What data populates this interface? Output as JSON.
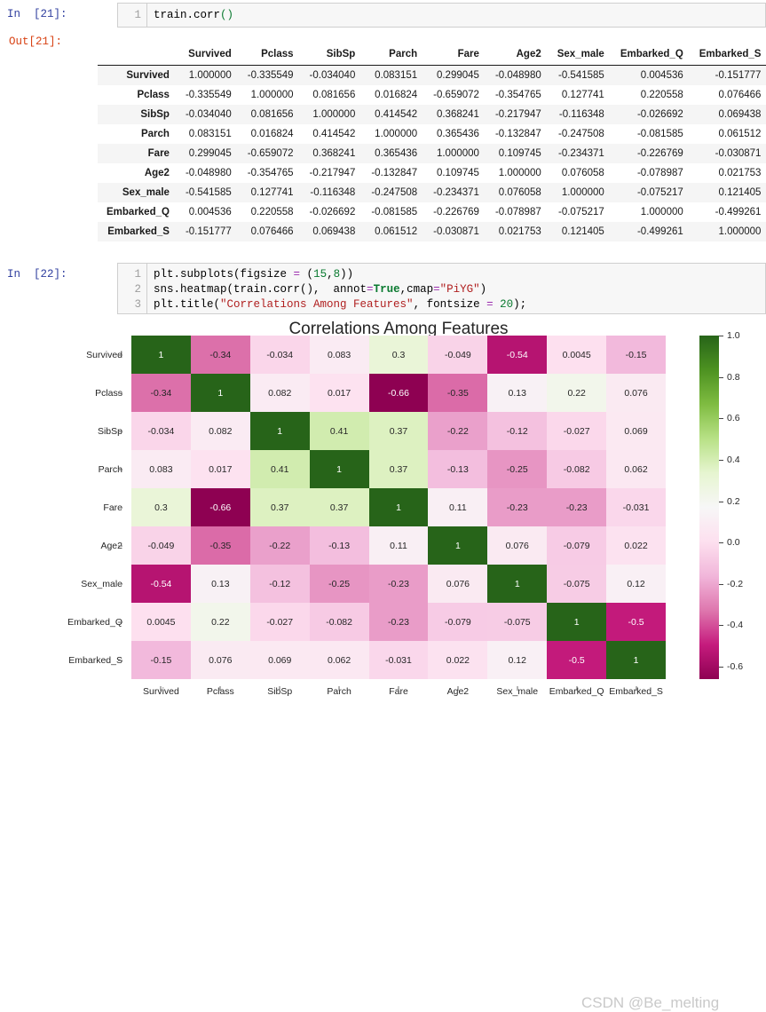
{
  "notebook": {
    "cells": [
      {
        "prompt_in": "In  [21]:",
        "code_lines": [
          "train.corr()"
        ],
        "line_numbers": [
          "1"
        ]
      },
      {
        "prompt_out": "Out[21]:"
      },
      {
        "prompt_in": "In  [22]:",
        "line_numbers": [
          "1",
          "2",
          "3"
        ]
      }
    ]
  },
  "code_cell_22": {
    "line1": "plt.subplots(figsize = (15,8))",
    "line2": "sns.heatmap(train.corr(),  annot=True,cmap=\"PiYG\")",
    "line3": "plt.title(\"Correlations Among Features\", fontsize = 20);",
    "tokens": {
      "l1_a": "plt.subplots(figsize ",
      "l1_eq": "=",
      "l1_b": " (",
      "l1_15": "15",
      "l1_c": ",",
      "l1_8": "8",
      "l1_d": "))",
      "l2_a": "sns.heatmap(train.corr(),  annot",
      "l2_eq": "=",
      "l2_true": "True",
      "l2_b": ",cmap",
      "l2_eq2": "=",
      "l2_str": "\"PiYG\"",
      "l2_c": ")",
      "l3_a": "plt.title(",
      "l3_str": "\"Correlations Among Features\"",
      "l3_b": ", fontsize ",
      "l3_eq": "=",
      "l3_c": " ",
      "l3_20": "20",
      "l3_d": ");"
    }
  },
  "dataframe": {
    "columns": [
      "Survived",
      "Pclass",
      "SibSp",
      "Parch",
      "Fare",
      "Age2",
      "Sex_male",
      "Embarked_Q",
      "Embarked_S"
    ],
    "index": [
      "Survived",
      "Pclass",
      "SibSp",
      "Parch",
      "Fare",
      "Age2",
      "Sex_male",
      "Embarked_Q",
      "Embarked_S"
    ],
    "rows": [
      [
        "1.000000",
        "-0.335549",
        "-0.034040",
        "0.083151",
        "0.299045",
        "-0.048980",
        "-0.541585",
        "0.004536",
        "-0.151777"
      ],
      [
        "-0.335549",
        "1.000000",
        "0.081656",
        "0.016824",
        "-0.659072",
        "-0.354765",
        "0.127741",
        "0.220558",
        "0.076466"
      ],
      [
        "-0.034040",
        "0.081656",
        "1.000000",
        "0.414542",
        "0.368241",
        "-0.217947",
        "-0.116348",
        "-0.026692",
        "0.069438"
      ],
      [
        "0.083151",
        "0.016824",
        "0.414542",
        "1.000000",
        "0.365436",
        "-0.132847",
        "-0.247508",
        "-0.081585",
        "0.061512"
      ],
      [
        "0.299045",
        "-0.659072",
        "0.368241",
        "0.365436",
        "1.000000",
        "0.109745",
        "-0.234371",
        "-0.226769",
        "-0.030871"
      ],
      [
        "-0.048980",
        "-0.354765",
        "-0.217947",
        "-0.132847",
        "0.109745",
        "1.000000",
        "0.076058",
        "-0.078987",
        "0.021753"
      ],
      [
        "-0.541585",
        "0.127741",
        "-0.116348",
        "-0.247508",
        "-0.234371",
        "0.076058",
        "1.000000",
        "-0.075217",
        "0.121405"
      ],
      [
        "0.004536",
        "0.220558",
        "-0.026692",
        "-0.081585",
        "-0.226769",
        "-0.078987",
        "-0.075217",
        "1.000000",
        "-0.499261"
      ],
      [
        "-0.151777",
        "0.076466",
        "0.069438",
        "0.061512",
        "-0.030871",
        "0.021753",
        "0.121405",
        "-0.499261",
        "1.000000"
      ]
    ]
  },
  "chart_data": {
    "type": "heatmap",
    "title": "Correlations Among Features",
    "xlabel": "",
    "ylabel": "",
    "cmap": "PiYG",
    "annot": true,
    "vmin": -0.66,
    "vmax": 1.0,
    "colorbar_ticks": [
      "1.0",
      "0.8",
      "0.6",
      "0.4",
      "0.2",
      "0.0",
      "-0.2",
      "-0.4",
      "-0.6"
    ],
    "colorbar_tick_values": [
      1.0,
      0.8,
      0.6,
      0.4,
      0.2,
      0.0,
      -0.2,
      -0.4,
      -0.6
    ],
    "x_categories": [
      "Survived",
      "Pclass",
      "SibSp",
      "Parch",
      "Fare",
      "Age2",
      "Sex_male",
      "Embarked_Q",
      "Embarked_S"
    ],
    "y_categories": [
      "Survived",
      "Pclass",
      "SibSp",
      "Parch",
      "Fare",
      "Age2",
      "Sex_male",
      "Embarked_Q",
      "Embarked_S"
    ],
    "values": [
      [
        1,
        -0.34,
        -0.034,
        0.083,
        0.3,
        -0.049,
        -0.54,
        0.0045,
        -0.15
      ],
      [
        -0.34,
        1,
        0.082,
        0.017,
        -0.66,
        -0.35,
        0.13,
        0.22,
        0.076
      ],
      [
        -0.034,
        0.082,
        1,
        0.41,
        0.37,
        -0.22,
        -0.12,
        -0.027,
        0.069
      ],
      [
        0.083,
        0.017,
        0.41,
        1,
        0.37,
        -0.13,
        -0.25,
        -0.082,
        0.062
      ],
      [
        0.3,
        -0.66,
        0.37,
        0.37,
        1,
        0.11,
        -0.23,
        -0.23,
        -0.031
      ],
      [
        -0.049,
        -0.35,
        -0.22,
        -0.13,
        0.11,
        1,
        0.076,
        -0.079,
        0.022
      ],
      [
        -0.54,
        0.13,
        -0.12,
        -0.25,
        -0.23,
        0.076,
        1,
        -0.075,
        0.12
      ],
      [
        0.0045,
        0.22,
        -0.027,
        -0.082,
        -0.23,
        -0.079,
        -0.075,
        1,
        -0.5
      ],
      [
        -0.15,
        0.076,
        0.069,
        0.062,
        -0.031,
        0.022,
        0.12,
        -0.5,
        1
      ]
    ],
    "annotations": [
      [
        "1",
        "-0.34",
        "-0.034",
        "0.083",
        "0.3",
        "-0.049",
        "-0.54",
        "0.0045",
        "-0.15"
      ],
      [
        "-0.34",
        "1",
        "0.082",
        "0.017",
        "-0.66",
        "-0.35",
        "0.13",
        "0.22",
        "0.076"
      ],
      [
        "-0.034",
        "0.082",
        "1",
        "0.41",
        "0.37",
        "-0.22",
        "-0.12",
        "-0.027",
        "0.069"
      ],
      [
        "0.083",
        "0.017",
        "0.41",
        "1",
        "0.37",
        "-0.13",
        "-0.25",
        "-0.082",
        "0.062"
      ],
      [
        "0.3",
        "-0.66",
        "0.37",
        "0.37",
        "1",
        "0.11",
        "-0.23",
        "-0.23",
        "-0.031"
      ],
      [
        "-0.049",
        "-0.35",
        "-0.22",
        "-0.13",
        "0.11",
        "1",
        "0.076",
        "-0.079",
        "0.022"
      ],
      [
        "-0.54",
        "0.13",
        "-0.12",
        "-0.25",
        "-0.23",
        "0.076",
        "1",
        "-0.075",
        "0.12"
      ],
      [
        "0.0045",
        "0.22",
        "-0.027",
        "-0.082",
        "-0.23",
        "-0.079",
        "-0.075",
        "1",
        "-0.5"
      ],
      [
        "-0.15",
        "0.076",
        "0.069",
        "0.062",
        "-0.031",
        "0.022",
        "0.12",
        "-0.5",
        "1"
      ]
    ]
  },
  "watermark": "CSDN @Be_melting"
}
